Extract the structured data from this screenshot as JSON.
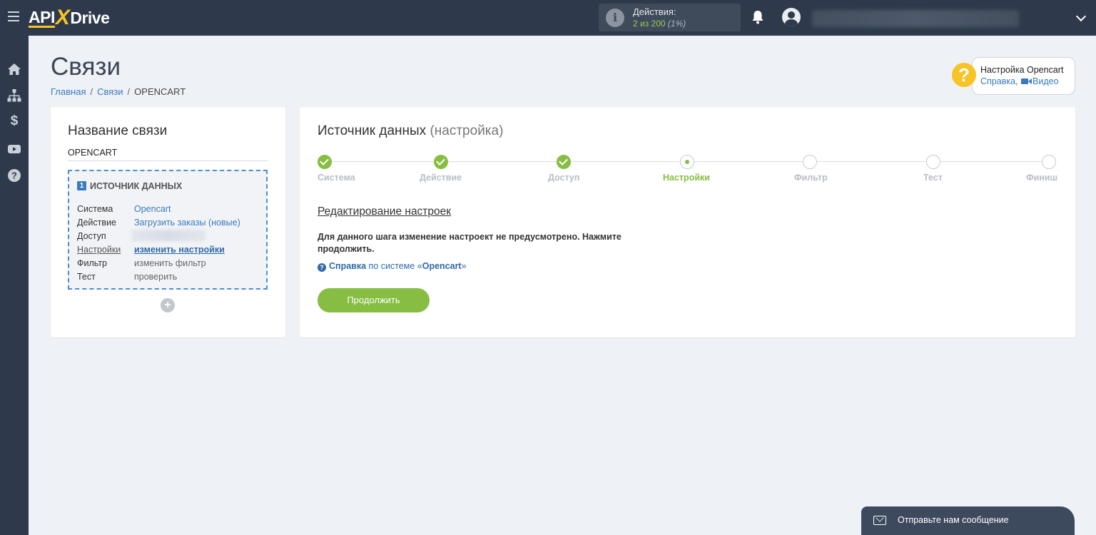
{
  "topbar": {
    "logo_api": "API",
    "logo_x": "X",
    "logo_drive": "Drive",
    "actions_label": "Действия:",
    "actions_used": "2 из 200",
    "actions_percent": "(1%)"
  },
  "header": {
    "title": "Связи",
    "breadcrumb": [
      "Главная",
      "Связи",
      "OPENCART"
    ]
  },
  "help": {
    "title": "Настройка Opencart",
    "link_help": "Справка,",
    "link_video": "Видео"
  },
  "connection": {
    "title": "Название связи",
    "name": "OPENCART",
    "source_number": "1",
    "source_title": "ИСТОЧНИК ДАННЫХ",
    "rows": [
      {
        "key": "Система",
        "value": "Opencart"
      },
      {
        "key": "Действие",
        "value": "Загрузить заказы (новые)"
      },
      {
        "key": "Доступ",
        "value": ""
      },
      {
        "key": "Настройки",
        "value": "изменить настройки"
      },
      {
        "key": "Фильтр",
        "value": "изменить фильтр"
      },
      {
        "key": "Тест",
        "value": "проверить"
      }
    ]
  },
  "main": {
    "title": "Источник данных",
    "subtitle": "(настройка)",
    "steps": [
      {
        "label": "Система",
        "state": "done"
      },
      {
        "label": "Действие",
        "state": "done"
      },
      {
        "label": "Доступ",
        "state": "done"
      },
      {
        "label": "Настройки",
        "state": "current"
      },
      {
        "label": "Фильтр",
        "state": "todo"
      },
      {
        "label": "Тест",
        "state": "todo"
      },
      {
        "label": "Финиш",
        "state": "todo"
      }
    ],
    "edit_title": "Редактирование настроек",
    "notice": "Для данного шага изменение настроект не предусмотрено. Нажмите продолжить.",
    "help_link_bold": "Справка",
    "help_link_mid": " по системе «",
    "help_link_system": "Opencart",
    "help_link_end": "»",
    "continue_label": "Продолжить"
  },
  "chat": {
    "label": "Отправьте нам сообщение"
  },
  "colors": {
    "topbar": "#2e3a4b",
    "accent_green": "#86bd42",
    "link_blue": "#3a7bbf",
    "logo_yellow": "#f7c325"
  }
}
